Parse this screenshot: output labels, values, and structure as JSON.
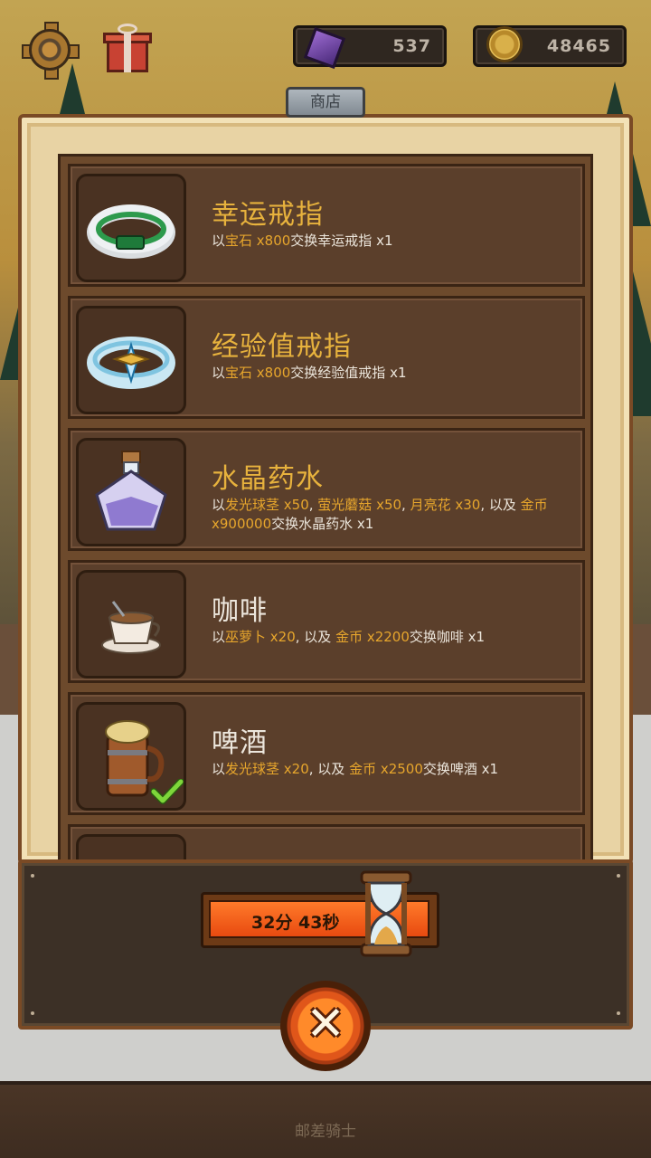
{
  "hud": {
    "gems": "537",
    "gold": "48465",
    "settings_icon": "gear-icon",
    "gift_icon": "gift-icon"
  },
  "shop": {
    "tab_label": "商店",
    "items": [
      {
        "name": "幸运戒指",
        "desc": [
          {
            "t": "以",
            "hl": false
          },
          {
            "t": "宝石 x800",
            "hl": true
          },
          {
            "t": "交换幸运戒指 x1",
            "hl": false
          }
        ],
        "icon": "lucky-ring-icon"
      },
      {
        "name": "经验值戒指",
        "desc": [
          {
            "t": "以",
            "hl": false
          },
          {
            "t": "宝石 x800",
            "hl": true
          },
          {
            "t": "交换经验值戒指 x1",
            "hl": false
          }
        ],
        "icon": "exp-ring-icon"
      },
      {
        "name": "水晶药水",
        "desc": [
          {
            "t": "以",
            "hl": false
          },
          {
            "t": "发光球茎 x50",
            "hl": true
          },
          {
            "t": ", ",
            "hl": false
          },
          {
            "t": "萤光蘑菇 x50",
            "hl": true
          },
          {
            "t": ", ",
            "hl": false
          },
          {
            "t": "月亮花 x30",
            "hl": true
          },
          {
            "t": ", 以及 ",
            "hl": false
          },
          {
            "t": "金币 x900000",
            "hl": true
          },
          {
            "t": "交换水晶药水 x1",
            "hl": false
          }
        ],
        "icon": "crystal-potion-icon"
      },
      {
        "name": "咖啡",
        "desc": [
          {
            "t": "以",
            "hl": false
          },
          {
            "t": "巫萝卜 x20",
            "hl": true
          },
          {
            "t": ", 以及 ",
            "hl": false
          },
          {
            "t": "金币 x2200",
            "hl": true
          },
          {
            "t": "交换咖啡 x1",
            "hl": false
          }
        ],
        "icon": "coffee-icon"
      },
      {
        "name": "啤酒",
        "desc": [
          {
            "t": "以",
            "hl": false
          },
          {
            "t": "发光球茎 x20",
            "hl": true
          },
          {
            "t": ", 以及 ",
            "hl": false
          },
          {
            "t": "金币 x2500",
            "hl": true
          },
          {
            "t": "交换啤酒 x1",
            "hl": false
          }
        ],
        "icon": "beer-icon",
        "owned": true
      }
    ]
  },
  "timer": {
    "label": "32分 43秒"
  },
  "footer": {
    "text": "邮差骑士"
  },
  "colors": {
    "highlight": "#e7a62c",
    "title": "#e7b23d"
  }
}
